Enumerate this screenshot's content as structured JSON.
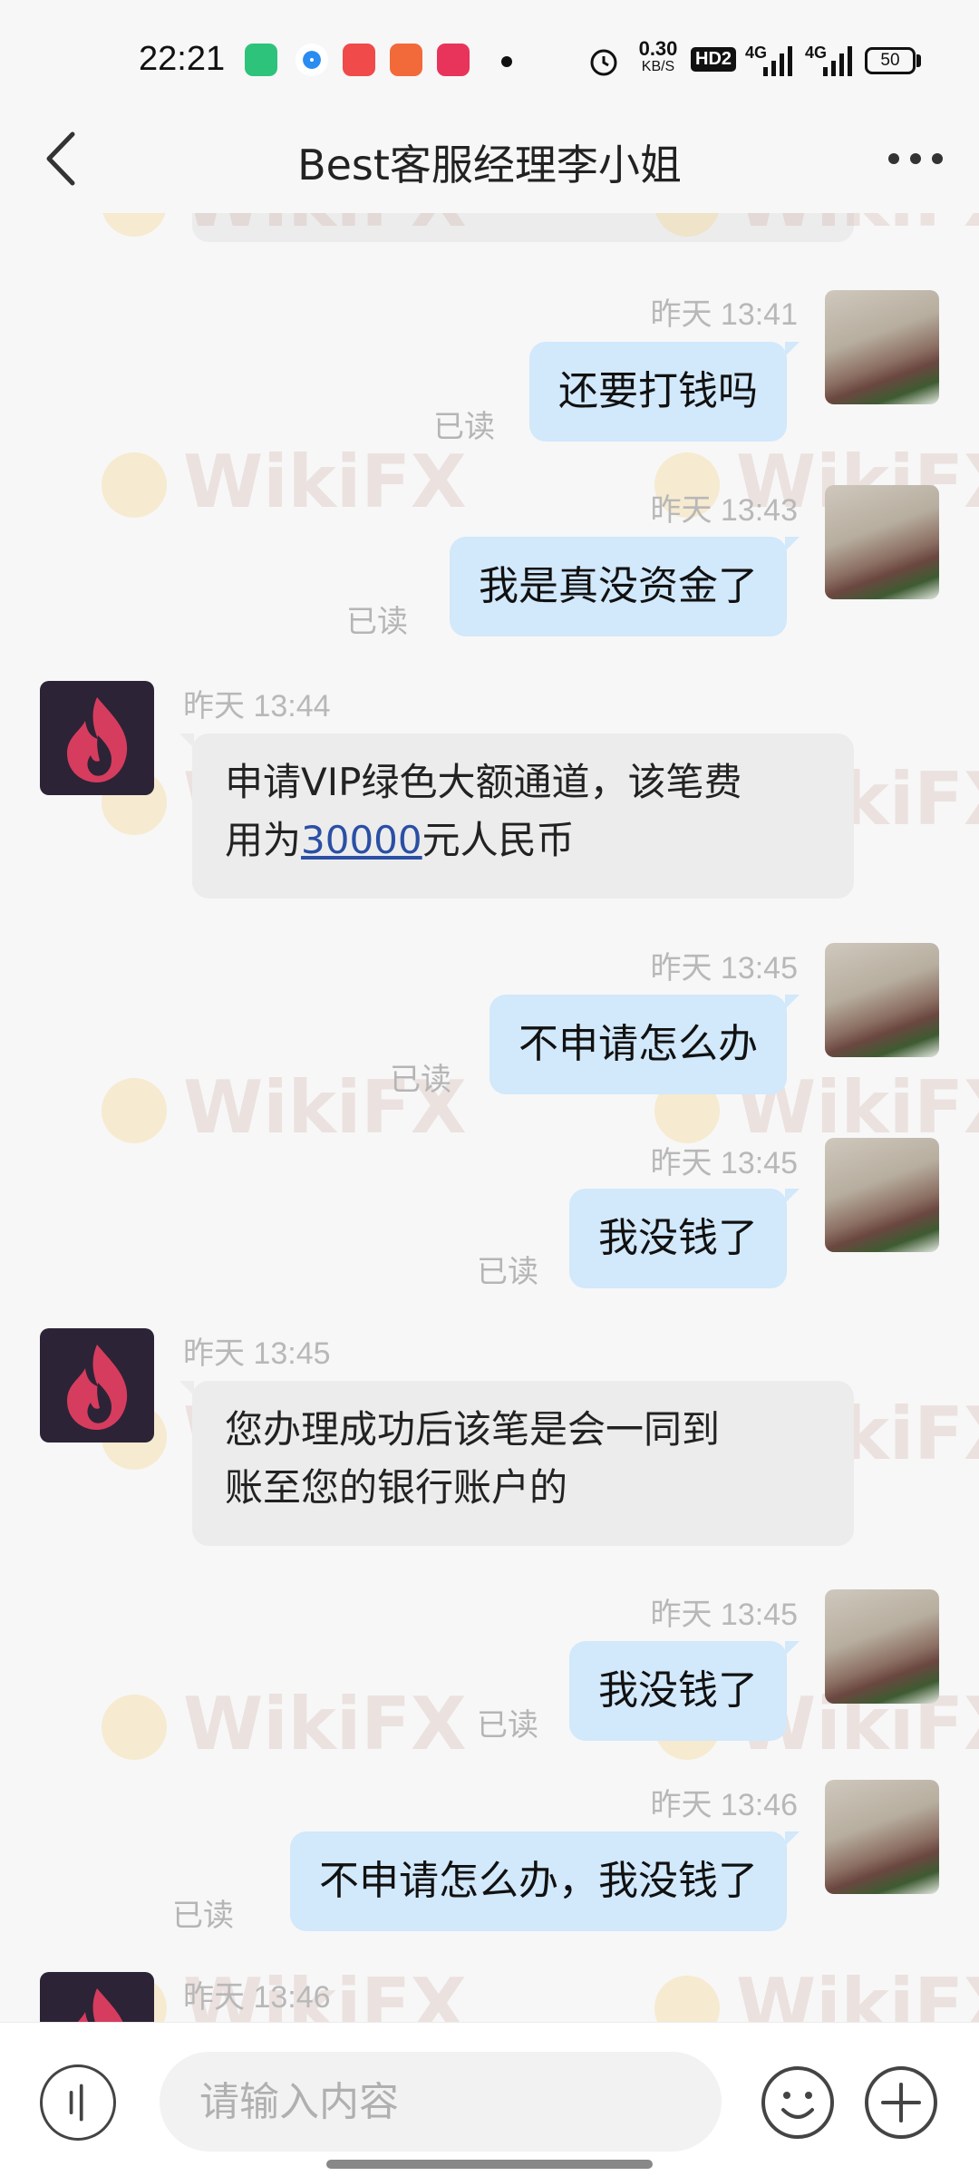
{
  "status_bar": {
    "time": "22:21",
    "net_speed_value": "0.30",
    "net_speed_unit": "KB/S",
    "hd_badge": "HD2",
    "network_1": "4G",
    "network_2": "4G",
    "battery": "50",
    "icons": [
      "app-green-icon",
      "app-blue-icon",
      "app-red-icon",
      "music-icon",
      "video-icon",
      "alarm-icon"
    ]
  },
  "header": {
    "title": "Best客服经理李小姐"
  },
  "messages": [
    {
      "from": "me",
      "time": "昨天 13:41",
      "text": "还要打钱吗",
      "status": "已读"
    },
    {
      "from": "me",
      "time": "昨天 13:43",
      "text": "我是真没资金了",
      "status": "已读"
    },
    {
      "from": "them",
      "time": "昨天 13:44",
      "line1": "申请VIP绿色大额通道，该笔费",
      "line2_pre": "用为",
      "amount": "30000",
      "line2_post": "元人民币"
    },
    {
      "from": "me",
      "time": "昨天 13:45",
      "text": "不申请怎么办",
      "status": "已读"
    },
    {
      "from": "me",
      "time": "昨天 13:45",
      "text": "我没钱了",
      "status": "已读"
    },
    {
      "from": "them",
      "time": "昨天 13:45",
      "line1": "您办理成功后该笔是会一同到",
      "line2": "账至您的银行账户的"
    },
    {
      "from": "me",
      "time": "昨天 13:45",
      "text": "我没钱了",
      "status": "已读"
    },
    {
      "from": "me",
      "time": "昨天 13:46",
      "text": "不申请怎么办，我没钱了",
      "status": "已读"
    },
    {
      "from": "them",
      "time": "昨天 13:46"
    }
  ],
  "input": {
    "placeholder": "请输入内容"
  },
  "watermark": "WikiFX",
  "colors": {
    "my_bubble": "#d2e8fb",
    "their_bubble": "#ececec",
    "link": "#2a4fa5",
    "background": "#f7f7f7"
  }
}
